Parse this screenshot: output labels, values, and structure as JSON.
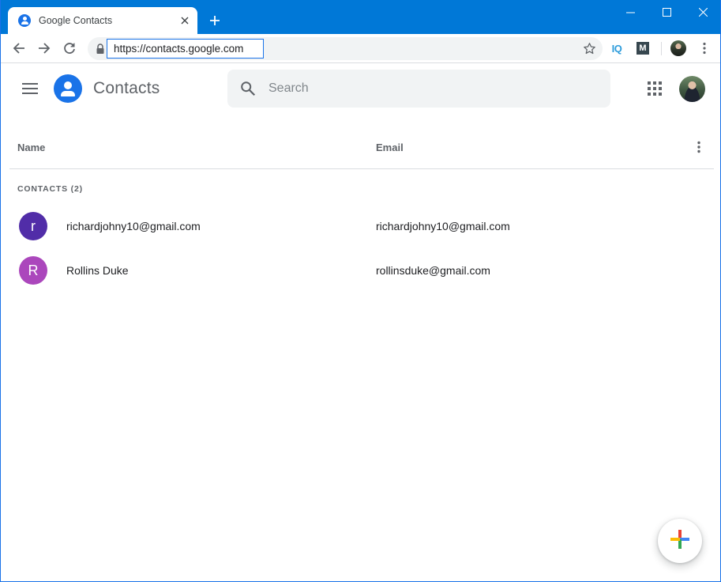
{
  "browser": {
    "tab_title": "Google Contacts",
    "url": "https://contacts.google.com",
    "titlebar_color": "#0078d7",
    "extensions": [
      {
        "name": "iq-extension-icon",
        "label": "IQ"
      },
      {
        "name": "m-extension-icon",
        "label": "M"
      }
    ]
  },
  "app": {
    "title": "Contacts",
    "brand_color": "#1a73e8",
    "search": {
      "placeholder": "Search"
    }
  },
  "list": {
    "columns": {
      "name": "Name",
      "email": "Email"
    },
    "section_label": "CONTACTS (2)",
    "contacts": [
      {
        "initial": "r",
        "name": "richardjohny10@gmail.com",
        "email": "richardjohny10@gmail.com",
        "color": "#512da8"
      },
      {
        "initial": "R",
        "name": "Rollins Duke",
        "email": "rollinsduke@gmail.com",
        "color": "#ab47bc"
      }
    ]
  },
  "fab": {
    "icon": "plus-icon",
    "colors": [
      "#ea4335",
      "#4285f4",
      "#34a853",
      "#fbbc04"
    ]
  }
}
